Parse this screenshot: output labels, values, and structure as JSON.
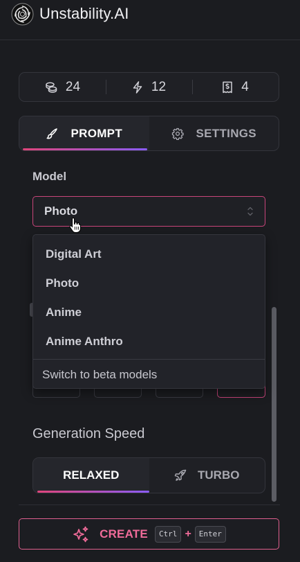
{
  "app": {
    "title": "Unstability.AI"
  },
  "stats": [
    {
      "icon": "coins-icon",
      "value": "24"
    },
    {
      "icon": "lightning-icon",
      "value": "12"
    },
    {
      "icon": "receipt-icon",
      "value": "4"
    }
  ],
  "tabs": [
    {
      "label": "PROMPT",
      "icon": "brush-icon",
      "active": true
    },
    {
      "label": "SETTINGS",
      "icon": "gear-icon",
      "active": false
    }
  ],
  "model": {
    "label": "Model",
    "selected": "Photo",
    "options": [
      "Digital Art",
      "Photo",
      "Anime",
      "Anime Anthro"
    ],
    "beta_link": "Switch to beta models"
  },
  "speed": {
    "label": "Generation Speed",
    "options": [
      {
        "label": "RELAXED",
        "active": true
      },
      {
        "label": "TURBO",
        "icon": "rocket-icon",
        "active": false
      }
    ]
  },
  "create": {
    "label": "CREATE",
    "icon": "sparkles-icon",
    "shortcut": [
      "Ctrl",
      "Enter"
    ],
    "plus": "+"
  },
  "colors": {
    "accent_pink": "#e0457b",
    "accent_purple": "#8a5cf6",
    "background": "#1b1c20"
  }
}
